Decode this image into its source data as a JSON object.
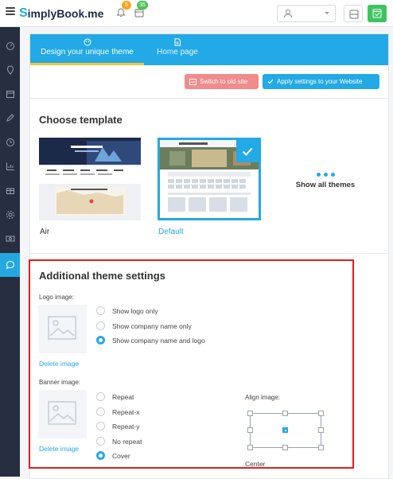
{
  "topbar": {
    "logo_prefix": "S",
    "logo_text": "implyBook.me",
    "notifications_count": "5",
    "bookings_count": "35"
  },
  "sidebar": {
    "items": [
      "dashboard-icon",
      "location-icon",
      "calendar-icon",
      "pen-icon",
      "clock-icon",
      "chart-icon",
      "gift-icon",
      "settings-icon",
      "money-icon",
      "chat-icon"
    ],
    "active_index": 9
  },
  "tabs": [
    {
      "label": "Design your unique theme",
      "icon": "palette-icon",
      "active": true
    },
    {
      "label": "Home page",
      "icon": "page-icon",
      "active": false
    }
  ],
  "actions": {
    "switch_label": "Switch to old site",
    "apply_label": "Apply settings to your Website"
  },
  "templates": {
    "heading": "Choose template",
    "items": [
      {
        "name": "Air",
        "selected": false
      },
      {
        "name": "Default",
        "selected": true
      }
    ],
    "show_all_label": "Show all themes"
  },
  "additional": {
    "heading": "Additional theme settings",
    "logo_label": "Logo image:",
    "logo_delete": "Delete image",
    "logo_options": [
      {
        "label": "Show logo only",
        "checked": false
      },
      {
        "label": "Show company name only",
        "checked": false
      },
      {
        "label": "Show company name and logo",
        "checked": true
      }
    ],
    "banner_label": "Banner image:",
    "banner_delete": "Delete image",
    "banner_options": [
      {
        "label": "Repeat",
        "checked": false
      },
      {
        "label": "Repeat-x",
        "checked": false
      },
      {
        "label": "Repeat-y",
        "checked": false
      },
      {
        "label": "No repeat",
        "checked": false
      },
      {
        "label": "Cover",
        "checked": true
      }
    ],
    "align_label": "Align image:",
    "align_value": "Center"
  },
  "colors": {
    "accent": "#23a9e6",
    "sidebar": "#262e3f",
    "highlight_border": "#e31c1c",
    "danger_button": "#f28b8b"
  }
}
